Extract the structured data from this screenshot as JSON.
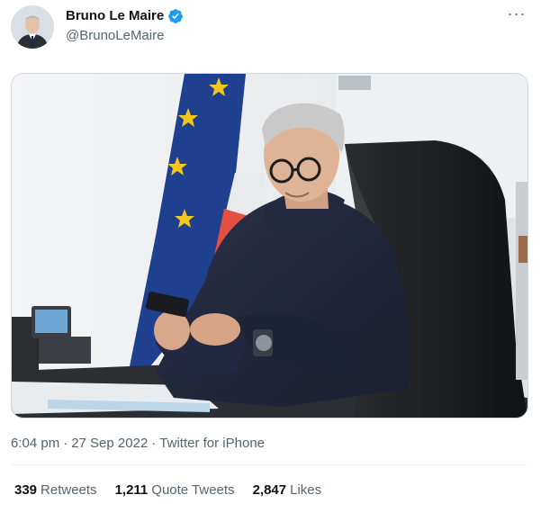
{
  "author": {
    "name": "Bruno Le Maire",
    "handle": "@BrunoLeMaire",
    "verified": true,
    "avatar_icon": "profile-photo"
  },
  "more_icon": "ellipsis-icon",
  "media": {
    "kind": "photo",
    "description_icon": "tweet-photo"
  },
  "meta": {
    "time": "6:04 pm",
    "date": "27 Sep 2022",
    "source": "Twitter for iPhone"
  },
  "stats": {
    "retweets_count": "339",
    "retweets_label": "Retweets",
    "quotes_count": "1,211",
    "quotes_label": "Quote Tweets",
    "likes_count": "2,847",
    "likes_label": "Likes"
  },
  "colors": {
    "verified": "#1d9bf0",
    "secondary_text": "#536471",
    "primary_text": "#0f1419"
  }
}
